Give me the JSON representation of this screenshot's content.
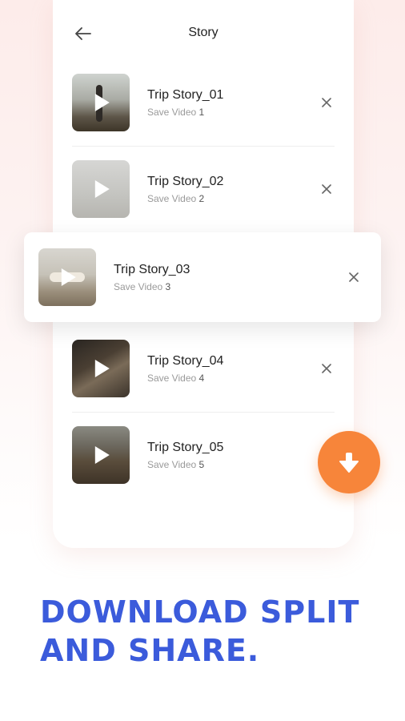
{
  "header": {
    "title": "Story"
  },
  "items": [
    {
      "name": "Trip Story_01",
      "sub_label": "Save Video",
      "num": "1"
    },
    {
      "name": "Trip Story_02",
      "sub_label": "Save Video",
      "num": "2"
    },
    {
      "name": "Trip Story_03",
      "sub_label": "Save Video",
      "num": "3"
    },
    {
      "name": "Trip Story_04",
      "sub_label": "Save Video",
      "num": "4"
    },
    {
      "name": "Trip Story_05",
      "sub_label": "Save Video",
      "num": "5"
    }
  ],
  "headline": {
    "line1": "DOWNLOAD SPLIT",
    "line2": "AND SHARE."
  },
  "icons": {
    "back": "arrow-left-icon",
    "close": "close-icon",
    "play": "play-icon",
    "download": "download-arrow-icon"
  },
  "colors": {
    "accent_orange": "#f7853a",
    "headline_blue": "#3b5bdb"
  }
}
